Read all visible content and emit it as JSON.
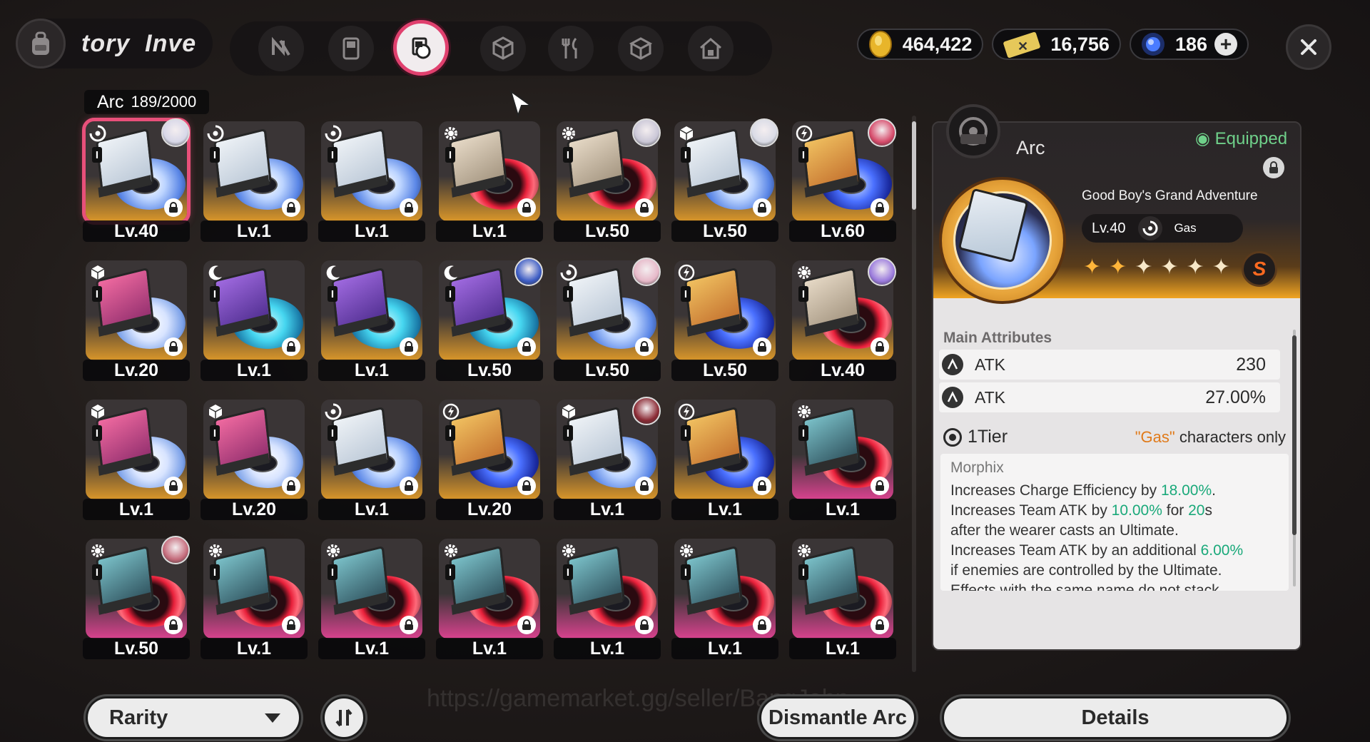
{
  "header": {
    "title": "tory  Inve",
    "category_tabs": [
      {
        "name": "neverness-tab",
        "icon": "n-logo-icon",
        "active": false
      },
      {
        "name": "device-tab",
        "icon": "gameboy-icon",
        "active": false
      },
      {
        "name": "arc-tab",
        "icon": "arc-disc-icon",
        "active": true
      },
      {
        "name": "cube-tab",
        "icon": "cube-icon",
        "active": false
      },
      {
        "name": "food-tab",
        "icon": "fork-knife-icon",
        "active": false
      },
      {
        "name": "box-tab",
        "icon": "package-icon",
        "active": false
      },
      {
        "name": "home-tab",
        "icon": "house-icon",
        "active": false
      }
    ],
    "currencies": [
      {
        "name": "gold-coin",
        "value": "464,422",
        "color": "#e8b52a"
      },
      {
        "name": "ticket",
        "value": "16,756",
        "color": "#e6c85a"
      },
      {
        "name": "crystal",
        "value": "186",
        "color": "#4a7cff"
      }
    ]
  },
  "inventory": {
    "category_label": "Arc",
    "count": "189/2000",
    "cards": [
      {
        "level": "Lv.40",
        "theme": "blue-swirl",
        "attr": "swirl",
        "avatar": "#d7d7e8",
        "selected": true
      },
      {
        "level": "Lv.1",
        "theme": "blue-swirl",
        "attr": "swirl",
        "avatar": null
      },
      {
        "level": "Lv.1",
        "theme": "blue-swirl",
        "attr": "swirl",
        "avatar": null
      },
      {
        "level": "Lv.1",
        "theme": "red-ring",
        "attr": "gear",
        "avatar": null
      },
      {
        "level": "Lv.50",
        "theme": "red-ring",
        "attr": "gear",
        "avatar": "#c9c6d6"
      },
      {
        "level": "Lv.50",
        "theme": "blue-swirl",
        "attr": "cube",
        "avatar": "#d9dbe6"
      },
      {
        "level": "Lv.60",
        "theme": "blue-lightning",
        "attr": "bolt",
        "avatar": "#d64a6a"
      },
      {
        "level": "Lv.20",
        "theme": "white-star",
        "attr": "cube",
        "avatar": null
      },
      {
        "level": "Lv.1",
        "theme": "cyan-wave",
        "attr": "moon",
        "avatar": null
      },
      {
        "level": "Lv.1",
        "theme": "cyan-wave",
        "attr": "moon",
        "avatar": null
      },
      {
        "level": "Lv.50",
        "theme": "cyan-wave",
        "attr": "moon",
        "avatar": "#3c5cc4"
      },
      {
        "level": "Lv.50",
        "theme": "blue-swirl",
        "attr": "swirl",
        "avatar": "#e6b8c8"
      },
      {
        "level": "Lv.50",
        "theme": "blue-lightning",
        "attr": "bolt",
        "avatar": null
      },
      {
        "level": "Lv.40",
        "theme": "red-ring",
        "attr": "gear",
        "avatar": "#9a7adc"
      },
      {
        "level": "Lv.1",
        "theme": "white-star",
        "attr": "cube",
        "avatar": null
      },
      {
        "level": "Lv.20",
        "theme": "white-star",
        "attr": "cube",
        "avatar": null
      },
      {
        "level": "Lv.1",
        "theme": "blue-swirl",
        "attr": "swirl",
        "avatar": null
      },
      {
        "level": "Lv.20",
        "theme": "blue-lightning",
        "attr": "bolt",
        "avatar": null
      },
      {
        "level": "Lv.1",
        "theme": "blue-swirl",
        "attr": "cube",
        "avatar": "#8a2a34"
      },
      {
        "level": "Lv.1",
        "theme": "blue-lightning",
        "attr": "bolt",
        "avatar": null
      },
      {
        "level": "Lv.1",
        "theme": "pink-red",
        "attr": "gear",
        "avatar": null
      },
      {
        "level": "Lv.50",
        "theme": "pink-red",
        "attr": "gear",
        "avatar": "#c46a7a"
      },
      {
        "level": "Lv.1",
        "theme": "pink-red",
        "attr": "gear",
        "avatar": null
      },
      {
        "level": "Lv.1",
        "theme": "pink-red",
        "attr": "gear",
        "avatar": null
      },
      {
        "level": "Lv.1",
        "theme": "pink-red",
        "attr": "gear",
        "avatar": null
      },
      {
        "level": "Lv.1",
        "theme": "pink-red",
        "attr": "gear",
        "avatar": null
      },
      {
        "level": "Lv.1",
        "theme": "pink-red",
        "attr": "gear",
        "avatar": null
      },
      {
        "level": "Lv.1",
        "theme": "pink-red",
        "attr": "gear",
        "avatar": null
      }
    ]
  },
  "detail": {
    "type_label": "Arc",
    "equipped_label": "Equipped",
    "arc_name": "Good Boy's Grand Adventure",
    "level": "Lv.40",
    "attribute": "Gas",
    "stars_filled": 2,
    "stars_total": 6,
    "rank": "S",
    "main_attributes_title": "Main Attributes",
    "main_attributes": [
      {
        "stat": "ATK",
        "value": "230"
      },
      {
        "stat": "ATK",
        "value": "27.00%"
      }
    ],
    "tier_label": "1Tier",
    "restriction_prefix": "\"Gas\"",
    "restriction_suffix": " characters only",
    "effect_title": "Morphix",
    "effect_lines": [
      [
        {
          "t": "Increases Charge Efficiency by "
        },
        {
          "t": "18.00%",
          "hl": true
        },
        {
          "t": "."
        }
      ],
      [
        {
          "t": "Increases Team ATK by "
        },
        {
          "t": "10.00%",
          "hl": true
        },
        {
          "t": " for "
        },
        {
          "t": "20",
          "hl": true
        },
        {
          "t": "s"
        }
      ],
      [
        {
          "t": "after the wearer casts an Ultimate."
        }
      ],
      [
        {
          "t": "Increases Team ATK by an additional "
        },
        {
          "t": "6.00%",
          "hl": true
        }
      ],
      [
        {
          "t": "if enemies are controlled by the Ultimate."
        }
      ],
      [
        {
          "t": "Effects with the same name do not stack."
        }
      ]
    ]
  },
  "footer": {
    "rarity_label": "Rarity",
    "dismantle_label": "Dismantle Arc",
    "details_label": "Details",
    "watermark": "https://gamemarket.gg/seller/BangJohn"
  }
}
